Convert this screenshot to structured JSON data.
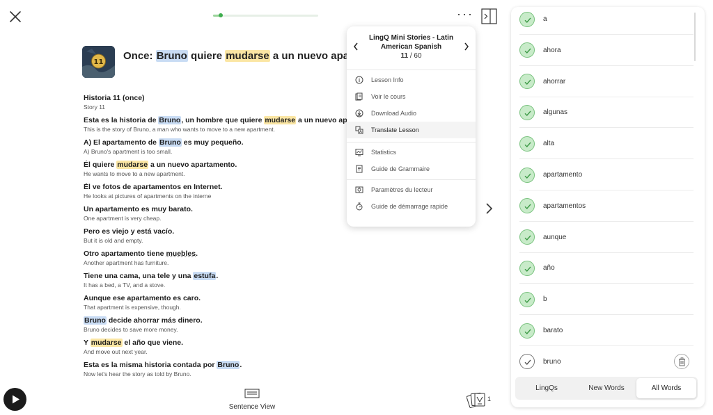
{
  "header": {
    "progress": {
      "fraction": 0.07
    }
  },
  "lesson": {
    "cover_number": "11",
    "title": {
      "prefix": "Once: ",
      "w1": "Bruno",
      "mid1": " quiere ",
      "w2": "mudarse",
      "suffix": " a un nuevo apartamento"
    }
  },
  "reader": {
    "p1": {
      "es": "Historia 11 (once)",
      "en": "Story 11"
    },
    "p2": {
      "es_a": "Esta es la historia de ",
      "es_w1": "Bruno",
      "es_b": ", un hombre que quiere ",
      "es_w2": "mudarse",
      "es_c": " a un nuevo apartamento.",
      "en": "This is the story of Bruno, a man who wants to move to a new apartment."
    },
    "p3": {
      "es_a": "A) El apartamento de ",
      "es_w1": "Bruno",
      "es_b": " es muy pequeño.",
      "en": "A) Bruno's apartment is too small."
    },
    "p4": {
      "es_a": "Él quiere ",
      "es_w1": "mudarse",
      "es_b": " a un nuevo apartamento.",
      "en": "He wants to move to a new apartment."
    },
    "p5": {
      "es": "Él ve fotos de apartamentos en Internet.",
      "en": "He looks at pictures of apartments on the interne"
    },
    "p6": {
      "es": "Un apartamento es muy barato.",
      "en": "One apartment is very cheap."
    },
    "p7": {
      "es": "Pero es viejo y está vacío.",
      "en": "But it is old and empty."
    },
    "p8": {
      "es_a": "Otro apartamento tiene ",
      "es_w1": "muebles",
      "es_b": ".",
      "en": "Another apartment has furniture."
    },
    "p9": {
      "es_a": "Tiene una cama, una tele y una ",
      "es_w1": "estufa",
      "es_b": ".",
      "en": "It has a bed, a TV, and a stove."
    },
    "p10": {
      "es": "Aunque ese apartamento es caro.",
      "en": "That apartment is expensive, though."
    },
    "p11": {
      "es_w1": "Bruno",
      "es_b": " decide ahorrar más dinero.",
      "en": "Bruno decides to save more money."
    },
    "p12": {
      "es_a": "Y ",
      "es_w1": "mudarse",
      "es_b": " el año que viene.",
      "en": "And move out next year."
    },
    "p13": {
      "es_a": "Esta es la misma historia contada por ",
      "es_w1": "Bruno",
      "es_b": ".",
      "en": "Now let's hear the story as told by Bruno."
    }
  },
  "menu": {
    "title": "LingQ Mini Stories - Latin American Spanish",
    "current": "11",
    "separator": " / ",
    "total": "60",
    "items": {
      "lesson_info": "Lesson Info",
      "voir_cours": "Voir le cours",
      "download_audio": "Download Audio",
      "translate_lesson": "Translate Lesson",
      "statistics": "Statistics",
      "grammar_guide": "Guide de Grammaire",
      "reader_settings": "Paramètres du lecteur",
      "quick_start": "Guide de démarrage rapide"
    }
  },
  "footer": {
    "sentence_view": "Sentence View",
    "cards_count": "1"
  },
  "vocab": {
    "words": [
      "a",
      "ahora",
      "ahorrar",
      "algunas",
      "alta",
      "apartamento",
      "apartamentos",
      "aunque",
      "año",
      "b",
      "barato",
      "bruno"
    ],
    "tabs": {
      "lingqs": "LingQs",
      "new_words": "New Words",
      "all_words": "All Words"
    }
  },
  "colors": {
    "known_green": "#c8ebc9",
    "highlight_blue": "#c9dcf4",
    "highlight_yellow": "#fbe6a4",
    "progress_green": "#3fae4f"
  },
  "icons": {
    "close": "close-icon",
    "more": "more-dots-icon",
    "panel": "sidebar-toggle-icon",
    "play": "play-icon",
    "sentence_view": "sentence-view-icon",
    "cards": "flashcards-icon",
    "check": "check-icon",
    "trash": "trash-icon"
  }
}
